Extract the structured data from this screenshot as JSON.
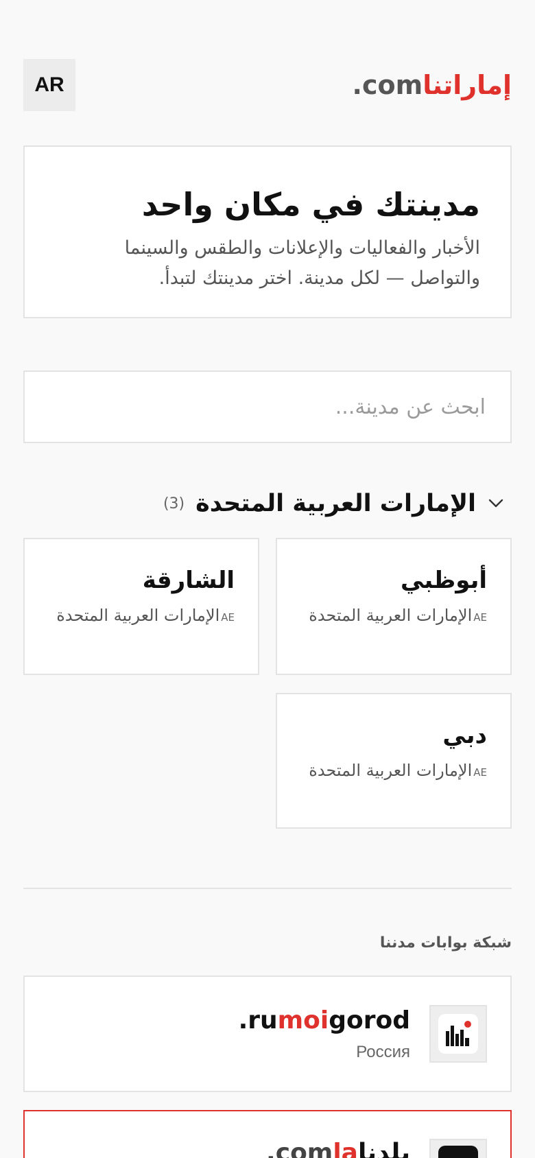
{
  "header": {
    "lang_button": "AR",
    "logo_text_ar": "إماراتنا",
    "logo_text_com": ".com"
  },
  "hero": {
    "title": "مدينتك في مكان واحد",
    "subtitle": "الأخبار والفعاليات والإعلانات والطقس والسينما والتواصل — لكل مدينة. اختر مدينتك لتبدأ."
  },
  "search": {
    "placeholder": "ابحث عن مدينة..."
  },
  "country_section": {
    "icon": "chevron-down-icon",
    "title": "الإمارات العربية المتحدة",
    "count": "(3)",
    "cities": [
      {
        "name": "أبوظبي",
        "code": "AE",
        "country": "الإمارات العربية المتحدة"
      },
      {
        "name": "الشارقة",
        "code": "AE",
        "country": "الإمارات العربية المتحدة"
      },
      {
        "name": "دبي",
        "code": "AE",
        "country": "الإمارات العربية المتحدة"
      }
    ]
  },
  "network": {
    "title": "شبكة بوابات مدننا",
    "portals": [
      {
        "name_prefix": ".ru",
        "name_red": "moi",
        "name_suffix": "gorod",
        "country": "Россия",
        "icon": "city-buildings-icon"
      },
      {
        "name_prefix": ".com",
        "name_red": "la",
        "name_suffix": "بلدنا",
        "country": "",
        "icon": "city-icon"
      }
    ]
  },
  "colors": {
    "accent": "#e0322d",
    "background": "#f9f9f9",
    "border": "#e3e3e3"
  }
}
